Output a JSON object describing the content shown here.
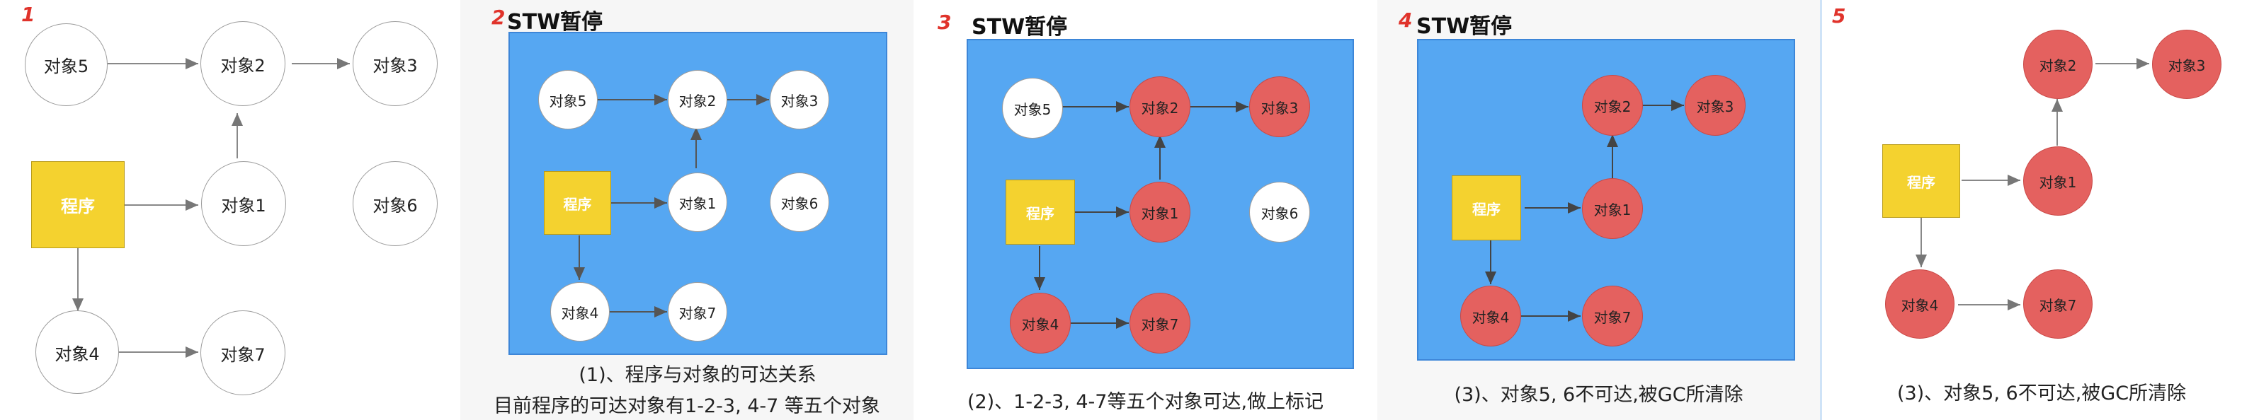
{
  "panels": [
    {
      "number": "1",
      "nodes": {
        "o5": "对象5",
        "o2": "对象2",
        "o3": "对象3",
        "prog": "程序",
        "o1": "对象1",
        "o6": "对象6",
        "o4": "对象4",
        "o7": "对象7"
      }
    },
    {
      "number": "2",
      "title": "STW暂停",
      "nodes": {
        "o5": "对象5",
        "o2": "对象2",
        "o3": "对象3",
        "prog": "程序",
        "o1": "对象1",
        "o6": "对象6",
        "o4": "对象4",
        "o7": "对象7"
      },
      "caption_line1": "(1)、程序与对象的可达关系",
      "caption_line2": "目前程序的可达对象有1-2-3, 4-7 等五个对象"
    },
    {
      "number": "3",
      "title": "STW暂停",
      "nodes": {
        "o5": "对象5",
        "o2": "对象2",
        "o3": "对象3",
        "prog": "程序",
        "o1": "对象1",
        "o6": "对象6",
        "o4": "对象4",
        "o7": "对象7"
      },
      "caption": "(2)、1-2-3, 4-7等五个对象可达,做上标记"
    },
    {
      "number": "4",
      "title": "STW暂停",
      "nodes": {
        "o2": "对象2",
        "o3": "对象3",
        "prog": "程序",
        "o1": "对象1",
        "o4": "对象4",
        "o7": "对象7"
      },
      "caption": "(3)、对象5, 6不可达,被GC所清除"
    },
    {
      "number": "5",
      "nodes": {
        "o2": "对象2",
        "o3": "对象3",
        "prog": "程序",
        "o1": "对象1",
        "o4": "对象4",
        "o7": "对象7"
      },
      "caption": "(3)、对象5, 6不可达,被GC所清除"
    }
  ],
  "colors": {
    "background_blue": "#56a7f2",
    "marked_red": "#e4615f",
    "program_yellow": "#f4d22f",
    "number_red": "#e0332b"
  }
}
